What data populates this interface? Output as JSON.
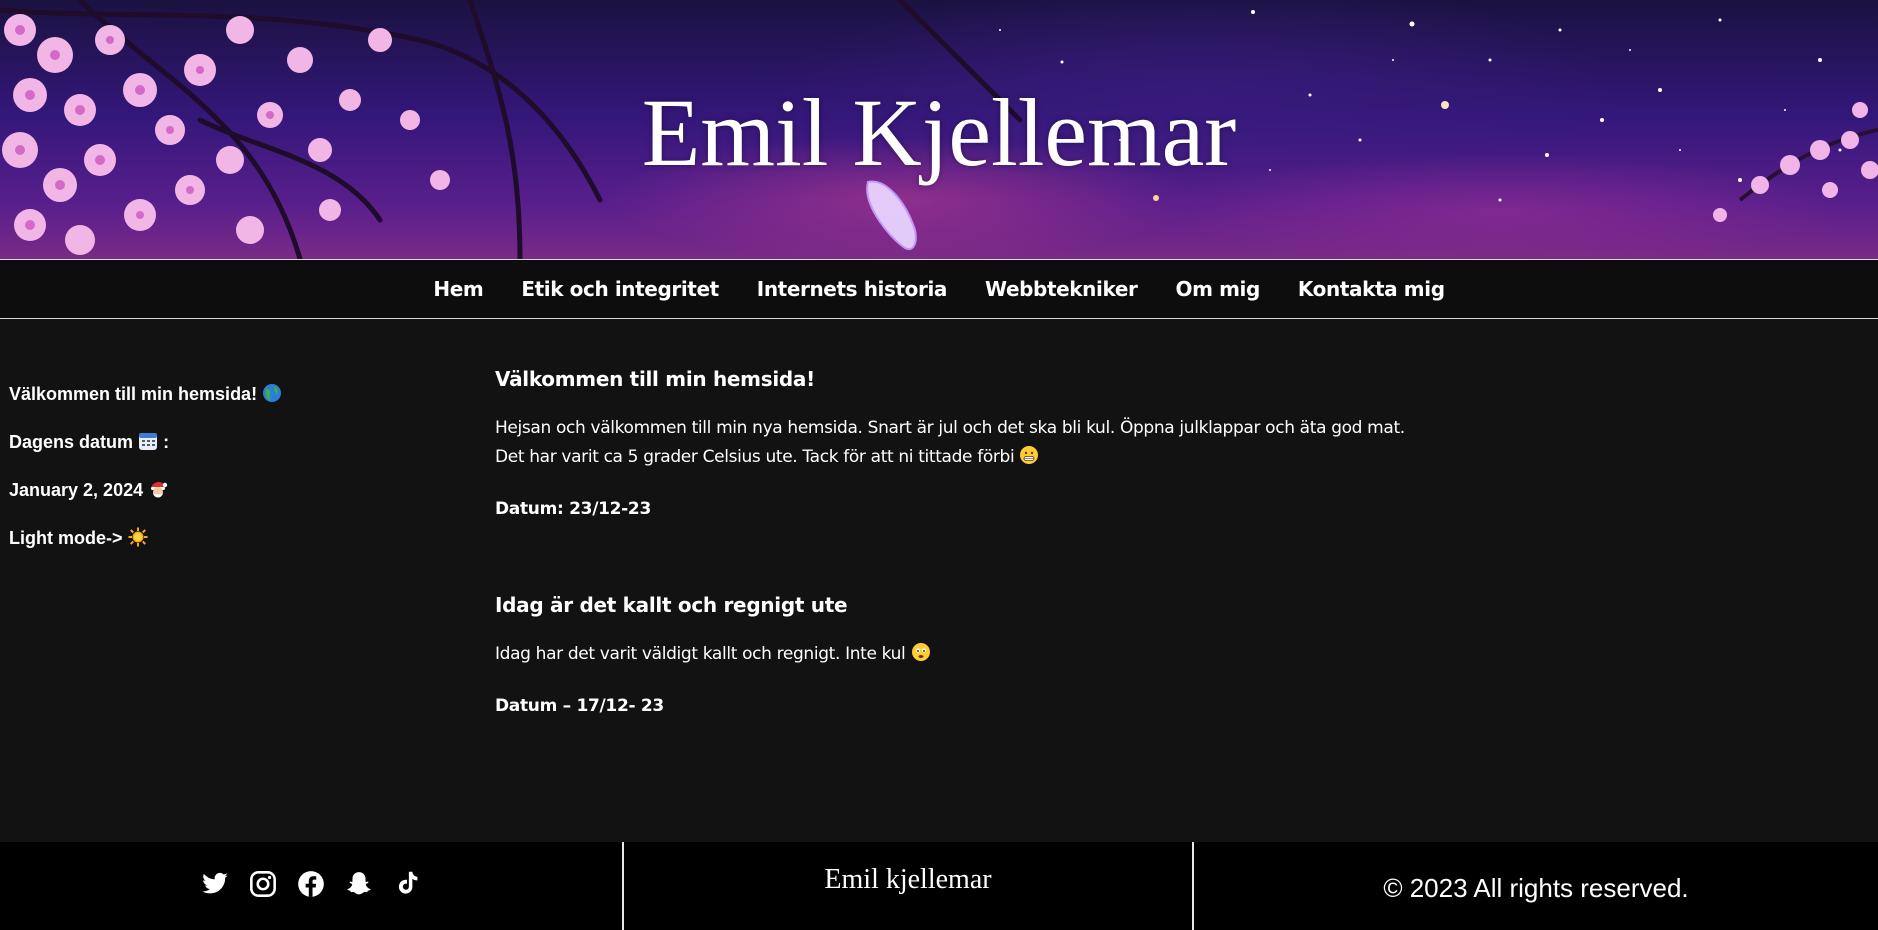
{
  "header": {
    "title": "Emil Kjellemar"
  },
  "nav": {
    "items": [
      {
        "label": "Hem"
      },
      {
        "label": "Etik och integritet"
      },
      {
        "label": "Internets historia"
      },
      {
        "label": "Webbtekniker"
      },
      {
        "label": "Om mig"
      },
      {
        "label": "Kontakta mig"
      }
    ]
  },
  "sidebar": {
    "welcome": "Välkommen till min hemsida!",
    "welcome_icon": "globe-icon",
    "date_label": "Dagens datum",
    "date_icon": "calendar-icon",
    "date_colon": ":",
    "date_value": "January 2, 2024",
    "date_value_icon": "santa-icon",
    "light_mode": "Light mode->",
    "light_mode_icon": "sun-icon"
  },
  "posts": [
    {
      "title": "Välkommen till min hemsida!",
      "line1": "Hejsan och välkommen till min nya hemsida. Snart är jul och det ska bli kul. Öppna julklappar och äta god mat.",
      "line2": "Det har varit ca 5 grader Celsius ute. Tack för att ni tittade förbi",
      "emoji_icon": "grimace-emoji-icon",
      "date": "Datum: 23/12-23"
    },
    {
      "title": "Idag är det kallt och regnigt ute",
      "line1": "Idag har det varit väldigt kallt och regnigt. Inte kul",
      "emoji_icon": "sad-emoji-icon",
      "date": "Datum – 17/12- 23"
    }
  ],
  "footer": {
    "social": [
      "twitter-icon",
      "instagram-icon",
      "facebook-icon",
      "snapchat-icon",
      "tiktok-icon"
    ],
    "name": "Emil kjellemar",
    "copyright": "© 2023 All rights reserved."
  },
  "colors": {
    "background": "#121212",
    "nav_background": "#0d0d0d",
    "footer_background": "#000000",
    "text": "#ffffff"
  }
}
